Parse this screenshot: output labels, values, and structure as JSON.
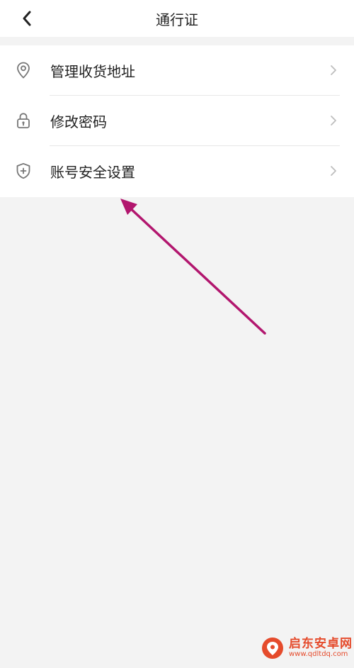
{
  "header": {
    "title": "通行证",
    "back_icon": "chevron-left-icon"
  },
  "menu": {
    "items": [
      {
        "label": "管理收货地址",
        "icon": "location-pin-icon"
      },
      {
        "label": "修改密码",
        "icon": "lock-icon"
      },
      {
        "label": "账号安全设置",
        "icon": "shield-plus-icon"
      }
    ]
  },
  "watermark": {
    "name": "启东安卓网",
    "url": "www.qdltdq.com"
  },
  "colors": {
    "background": "#f3f3f3",
    "card": "#ffffff",
    "annotation_arrow": "#b2166e",
    "watermark": "#e54b2c"
  }
}
